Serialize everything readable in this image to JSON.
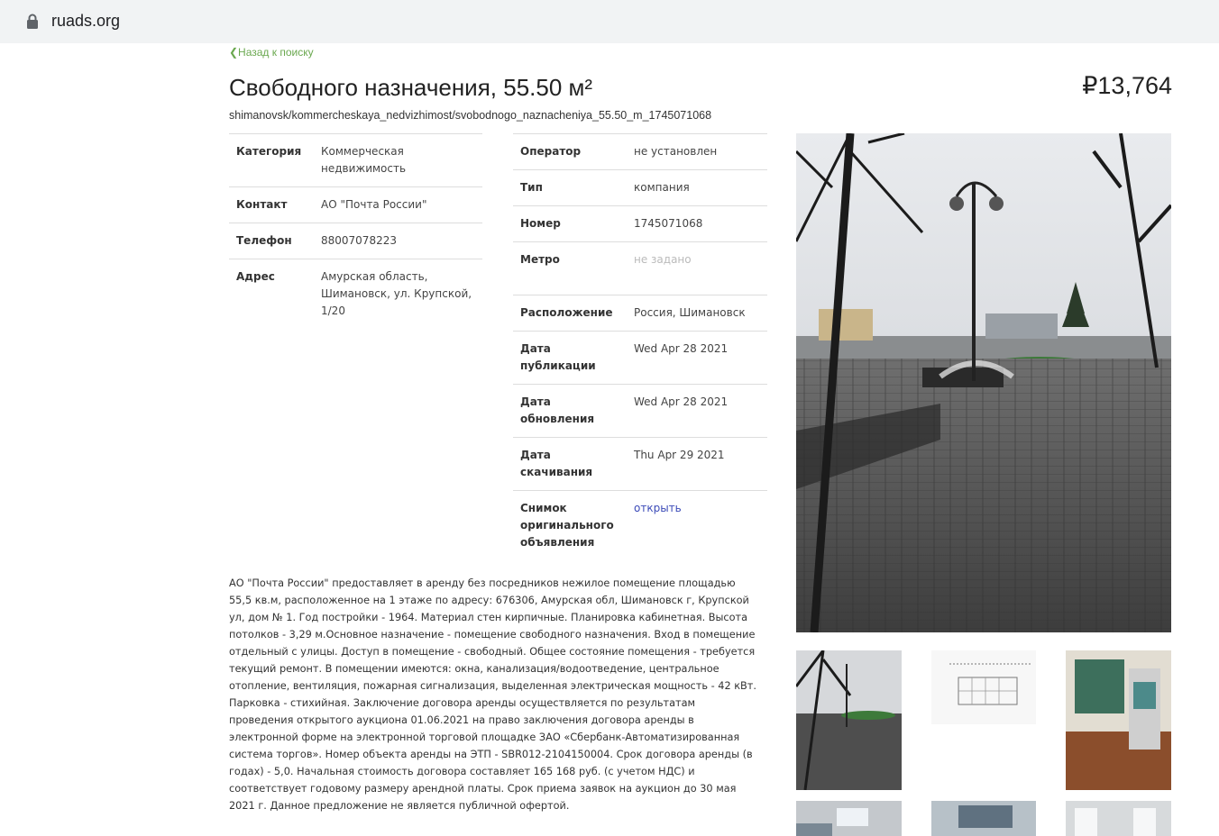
{
  "browser": {
    "url": "ruads.org"
  },
  "listing": {
    "back_link": "❮Назад к поиску",
    "title": "Свободного назначения, 55.50 м²",
    "price": "₽13,764",
    "slug": "shimanovsk/kommercheskaya_nedvizhimost/svobodnogo_naznacheniya_55.50_m_1745071068",
    "left_table": [
      {
        "label": "Категория",
        "value": "Коммерческая недвижимость"
      },
      {
        "label": "Контакт",
        "value": "АО \"Почта России\""
      },
      {
        "label": "Телефон",
        "value": "88007078223"
      },
      {
        "label": "Адрес",
        "value": "Амурская область, Шимановск, ул. Крупской, 1/20"
      }
    ],
    "right_table": [
      {
        "label": "Оператор",
        "value": "не установлен"
      },
      {
        "label": "Тип",
        "value": "компания"
      },
      {
        "label": "Номер",
        "value": "1745071068"
      },
      {
        "label": "Метро",
        "value": "не задано"
      },
      {
        "label": "Расположение",
        "value": "Россия, Шимановск"
      },
      {
        "label": "Дата публикации",
        "value": "Wed Apr 28 2021"
      },
      {
        "label": "Дата обновления",
        "value": "Wed Apr 28 2021"
      },
      {
        "label": "Дата скачивания",
        "value": "Thu Apr 29 2021"
      },
      {
        "label": "Снимок оригинального объявления",
        "value": "открыть"
      }
    ],
    "description": "АО \"Почта России\" предоставляет в аренду без посредников нежилое помещение площадью 55,5 кв.м, расположенное на 1 этаже по адресу: 676306, Амурская обл, Шимановск г, Крупской ул, дом № 1. Год постройки - 1964. Материал стен кирпичные. Планировка кабинетная. Высота потолков - 3,29 м.Основное назначение - помещение свободного назначения. Вход в помещение отдельный с улицы. Доступ в помещение - свободный. Общее состояние помещения - требуется текущий ремонт. В помещении имеются: окна, канализация/водоотведение, центральное отопление, вентиляция, пожарная сигнализация, выделенная электрическая мощность - 42 кВт. Парковка - стихийная. Заключение договора аренды осуществляется по результатам проведения открытого аукциона 01.06.2021 на право заключения договора аренды в электронной форме на электронной торговой площадке ЗАО «Сбербанк-Автоматизированная система торгов». Номер объекта аренды на ЭТП - SBR012-2104150004. Срок договора аренды (в годах) - 5,0. Начальная стоимость договора составляет 165 168 руб. (с учетом НДС) и соответствует годовому размеру арендной платы. Срок приема заявок на аукцион до 30 мая 2021 г. Данное предложение не является публичной офертой."
  }
}
